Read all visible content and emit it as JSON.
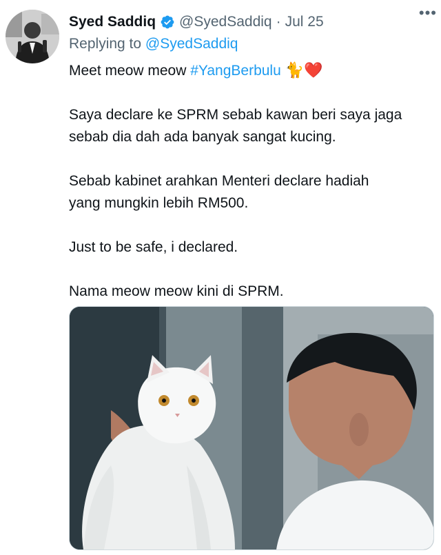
{
  "tweet": {
    "author": {
      "name": "Syed Saddiq",
      "handle": "@SyedSaddiq",
      "verified_icon": "verified-badge-icon"
    },
    "separator": "·",
    "date": "Jul 25",
    "more_label": "•••",
    "reply": {
      "prefix": "Replying to",
      "mention": "@SyedSaddiq"
    },
    "text": {
      "line1_prefix": "Meet meow meow",
      "hashtag": "#YangBerbulu",
      "emoji": "🐈❤️",
      "para1_line1": "Saya declare ke SPRM sebab kawan beri saya jaga",
      "para1_line2": "sebab dia dah ada banyak sangat kucing.",
      "para2_line1": "Sebab kabinet arahkan Menteri declare hadiah",
      "para2_line2": "yang mungkin lebih RM500.",
      "para3": "Just to be safe, i declared.",
      "para4": "Nama meow meow kini di SPRM."
    },
    "media": {
      "description_icon": "photo-man-holding-white-cat"
    }
  },
  "colors": {
    "link": "#1d9bf0",
    "secondary_text": "#536471",
    "verified": "#1d9bf0",
    "border": "#cfd9de"
  }
}
